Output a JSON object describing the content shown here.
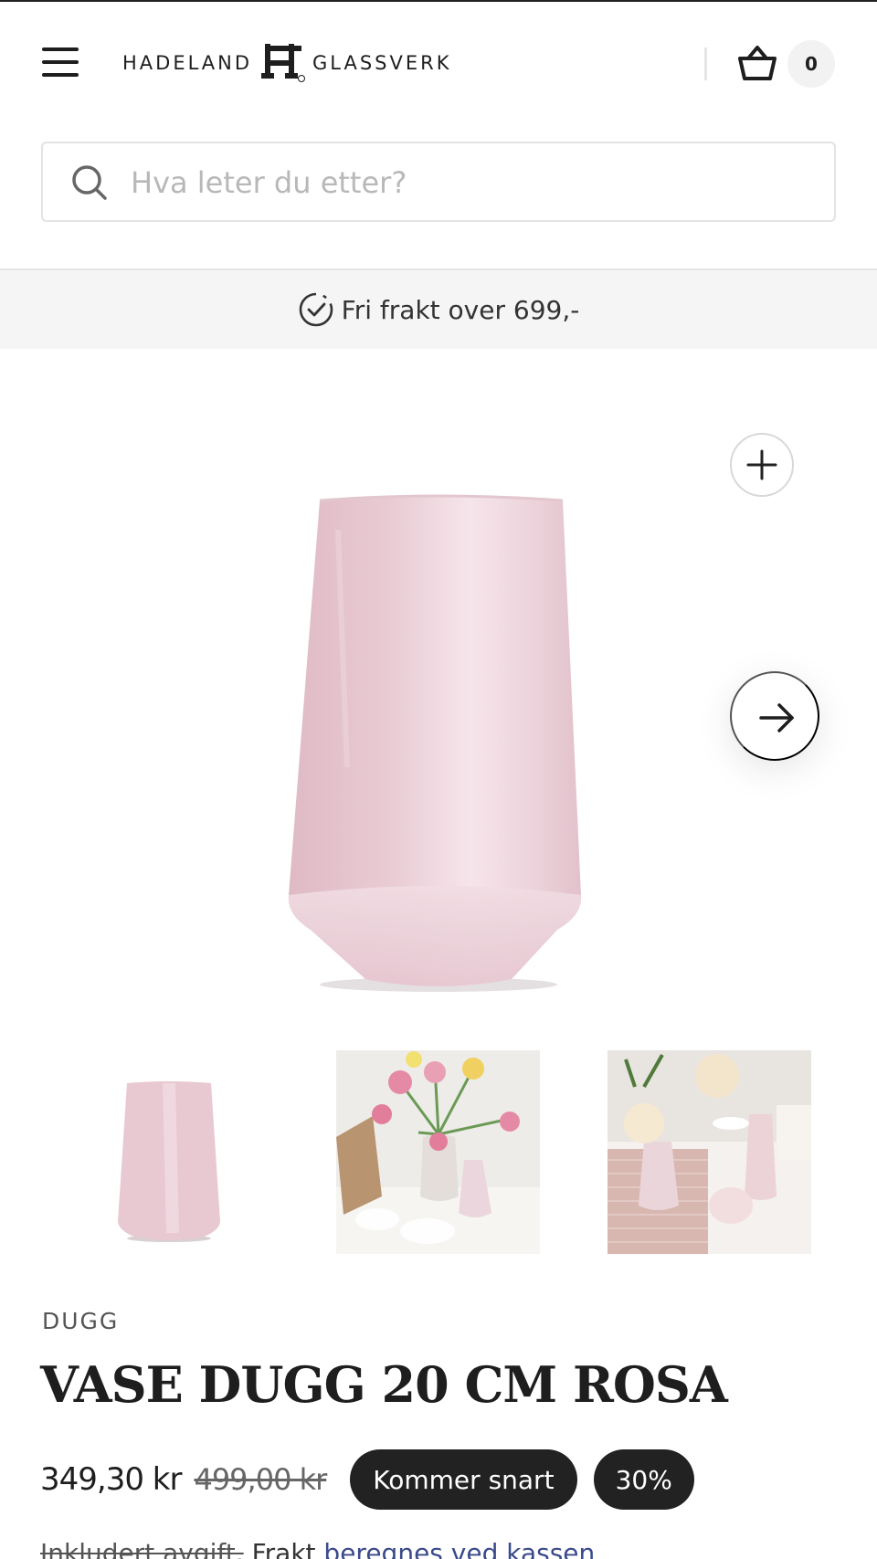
{
  "header": {
    "logo_left": "HADELAND",
    "logo_right": "GLASSVERK",
    "cart_count": "0"
  },
  "search": {
    "placeholder": "Hva leter du etter?"
  },
  "banner": {
    "shipping_text": "Fri frakt over 699,-"
  },
  "product": {
    "brand": "DUGG",
    "title": "VASE DUGG 20 CM ROSA",
    "price": "349,30 kr",
    "old_price": "499,00 kr",
    "badge_status": "Kommer snart",
    "badge_discount": "30%",
    "tax_label": "Inkludert avgift.",
    "shipping_label": "Frakt",
    "shipping_link": "beregnes ved kassen"
  },
  "icons": {
    "menu": "hamburger-icon",
    "basket": "basket-icon",
    "search": "search-icon",
    "check": "check-circle-icon",
    "zoom": "plus-icon",
    "next": "arrow-right-icon"
  },
  "colors": {
    "text": "#1e1e1e",
    "banner_bg": "#f5f5f5",
    "badge_bg": "#222222",
    "vase_pink": "#e9c9d2"
  }
}
